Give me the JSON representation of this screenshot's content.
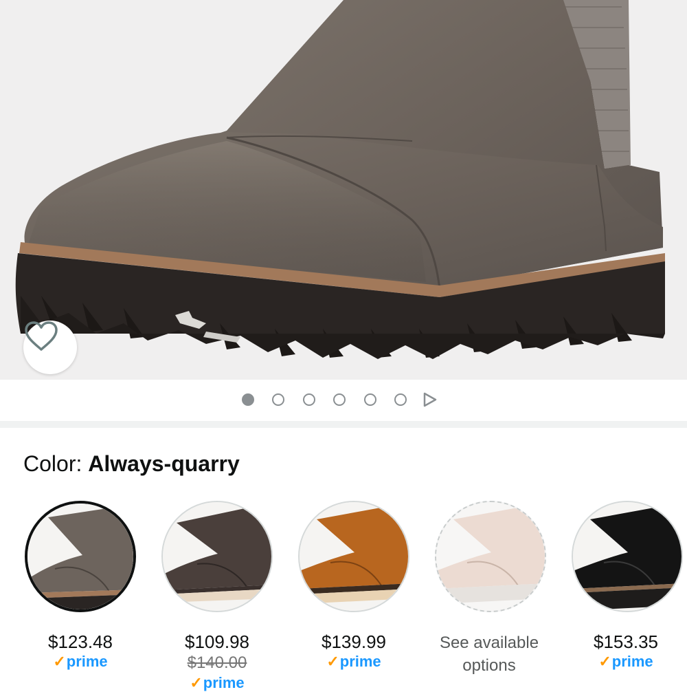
{
  "hero": {
    "image_name": "product-image-boot",
    "favorite_icon": "heart-outline-icon",
    "carousel": {
      "total_images": 6,
      "active_index": 0,
      "next_icon": "play-triangle-icon"
    }
  },
  "color": {
    "label": "Color: ",
    "selected_name": "Always-quarry"
  },
  "swatches": [
    {
      "price": "$123.48",
      "list_price": "",
      "prime": "prime",
      "selected": true,
      "color": "#6d645d"
    },
    {
      "price": "$109.98",
      "list_price": "$140.00",
      "prime": "prime",
      "selected": false,
      "color": "#4a3f3b"
    },
    {
      "price": "$139.99",
      "list_price": "",
      "prime": "prime",
      "selected": false,
      "color": "#b8661f"
    },
    {
      "price": "",
      "availability": "See available options",
      "selected": false,
      "color": "#ecdbd2"
    },
    {
      "price": "$153.35",
      "list_price": "",
      "prime": "prime",
      "selected": false,
      "color": "#141414"
    }
  ],
  "prime_check": "✓",
  "colors": {
    "prime_blue": "#1a98ff",
    "prime_check_orange": "#ff9900",
    "selected_border": "#0f1111"
  }
}
